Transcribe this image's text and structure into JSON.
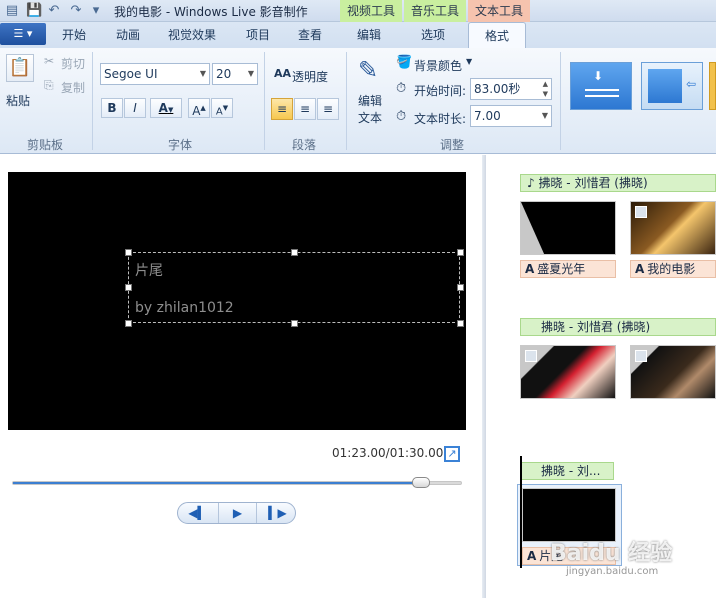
{
  "window": {
    "title": "我的电影 - Windows Live 影音制作",
    "context_groups": {
      "video_tools": "视频工具",
      "music_tools": "音乐工具",
      "text_tools": "文本工具"
    }
  },
  "tabs": {
    "app_menu": "☰ ▾",
    "home": "开始",
    "animation": "动画",
    "visual_effects": "视觉效果",
    "project": "项目",
    "view": "查看",
    "edit": "编辑",
    "options": "选项",
    "format": "格式"
  },
  "ribbon": {
    "clipboard": {
      "paste": "粘贴",
      "cut": "剪切",
      "copy": "复制",
      "label": "剪贴板"
    },
    "font": {
      "family": "Segoe UI",
      "size": "20",
      "bold": "B",
      "italic": "I",
      "color": "A",
      "grow": "A",
      "shrink": "A",
      "label": "字体"
    },
    "paragraph": {
      "transparency": "透明度",
      "label": "段落"
    },
    "adjust": {
      "edit_text_line1": "编辑",
      "edit_text_line2": "文本",
      "background_color": "背景颜色",
      "start_time_label": "开始时间:",
      "start_time_value": "83.00秒",
      "duration_label": "文本时长:",
      "duration_value": "7.00",
      "label": "调整"
    }
  },
  "preview": {
    "caption_title": "片尾",
    "caption_subtitle": "by zhilan1012",
    "timecode": "01:23.00/01:30.00",
    "progress": 0.922
  },
  "storyboard": {
    "music_1": "拂晓 - 刘惜君 (拂晓)",
    "caption_1": "盛夏光年",
    "caption_2": "我的电影",
    "music_2": "拂晓 - 刘惜君 (拂晓)",
    "music_3": "拂晓 - 刘...",
    "caption_3": "片尾"
  },
  "watermark": {
    "brand": "Baidu 经验",
    "url": "jingyan.baidu.com"
  },
  "colors": {
    "accent": "#3c7fd1",
    "music_bar": "#d8f2c8",
    "caption_bar": "#fbe4d6",
    "video_tools_tab": "#c9ef9f",
    "music_tools_tab": "#c9ef9f",
    "text_tools_tab": "#f6c3ae"
  }
}
